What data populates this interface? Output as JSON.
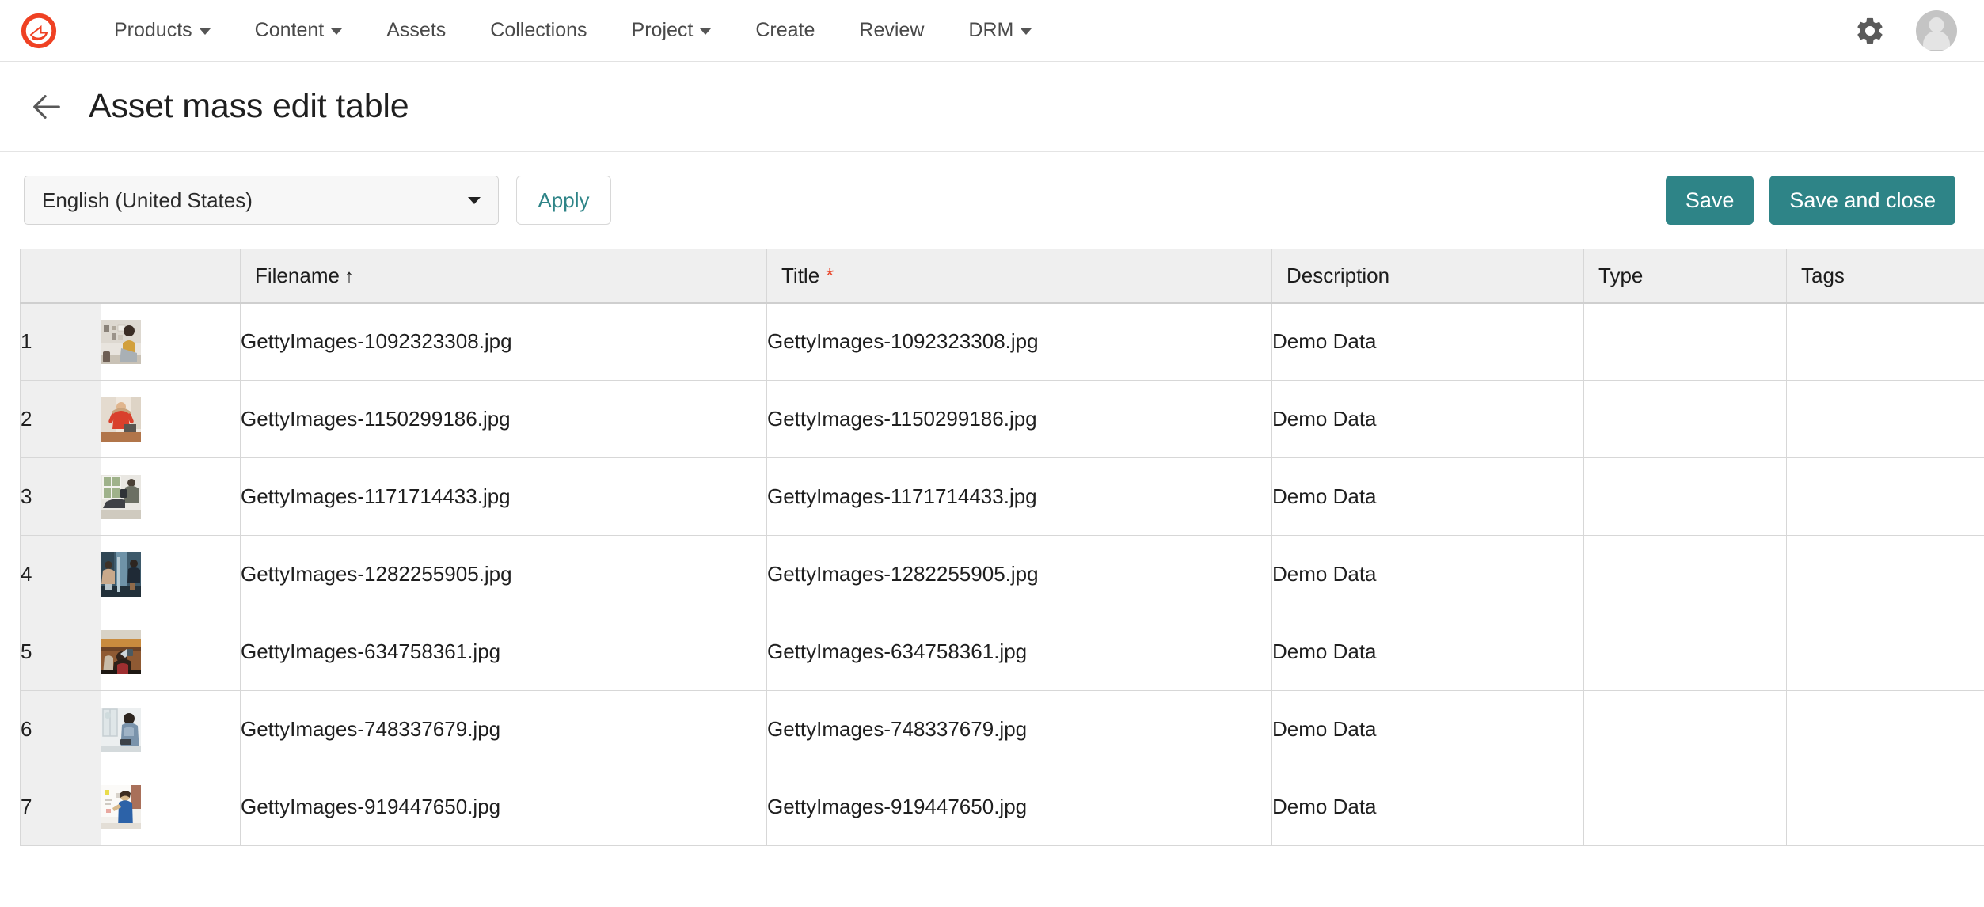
{
  "nav": {
    "logo_icon": "brand-ring-logo",
    "items": [
      {
        "label": "Products",
        "has_caret": true
      },
      {
        "label": "Content",
        "has_caret": true
      },
      {
        "label": "Assets",
        "has_caret": false
      },
      {
        "label": "Collections",
        "has_caret": false
      },
      {
        "label": "Project",
        "has_caret": true
      },
      {
        "label": "Create",
        "has_caret": false
      },
      {
        "label": "Review",
        "has_caret": false
      },
      {
        "label": "DRM",
        "has_caret": true
      }
    ],
    "settings_icon": "gear-icon",
    "avatar_icon": "user-avatar-icon"
  },
  "titlebar": {
    "back_icon": "back-arrow-icon",
    "title": "Asset mass edit table"
  },
  "toolbar": {
    "language_selected": "English (United States)",
    "apply_label": "Apply",
    "save_label": "Save",
    "save_and_close_label": "Save and close",
    "accent_color": "#2e8487",
    "apply_text_color": "#2e8487"
  },
  "table": {
    "columns": [
      {
        "key": "number",
        "label": ""
      },
      {
        "key": "thumbnail",
        "label": ""
      },
      {
        "key": "filename",
        "label": "Filename",
        "sort": "↑"
      },
      {
        "key": "title",
        "label": "Title",
        "required": "*"
      },
      {
        "key": "description",
        "label": "Description"
      },
      {
        "key": "type",
        "label": "Type"
      },
      {
        "key": "tags",
        "label": "Tags"
      }
    ],
    "required_marker_color": "#e8492e",
    "rows": [
      {
        "number": "1",
        "filename": "GettyImages-1092323308.jpg",
        "title": "GettyImages-1092323308.jpg",
        "description": "Demo Data",
        "type": "",
        "tags": "",
        "thumbnail_alt": "woman-at-desk-thumbnail"
      },
      {
        "number": "2",
        "filename": "GettyImages-1150299186.jpg",
        "title": "GettyImages-1150299186.jpg",
        "description": "Demo Data",
        "type": "",
        "tags": "",
        "thumbnail_alt": "woman-in-red-stretching-thumbnail"
      },
      {
        "number": "3",
        "filename": "GettyImages-1171714433.jpg",
        "title": "GettyImages-1171714433.jpg",
        "description": "Demo Data",
        "type": "",
        "tags": "",
        "thumbnail_alt": "person-reading-by-window-thumbnail"
      },
      {
        "number": "4",
        "filename": "GettyImages-1282255905.jpg",
        "title": "GettyImages-1282255905.jpg",
        "description": "Demo Data",
        "type": "",
        "tags": "",
        "thumbnail_alt": "people-at-counter-thumbnail"
      },
      {
        "number": "5",
        "filename": "GettyImages-634758361.jpg",
        "title": "GettyImages-634758361.jpg",
        "description": "Demo Data",
        "type": "",
        "tags": "",
        "thumbnail_alt": "person-at-wooden-table-thumbnail"
      },
      {
        "number": "6",
        "filename": "GettyImages-748337679.jpg",
        "title": "GettyImages-748337679.jpg",
        "description": "Demo Data",
        "type": "",
        "tags": "",
        "thumbnail_alt": "woman-thinking-by-window-thumbnail"
      },
      {
        "number": "7",
        "filename": "GettyImages-919447650.jpg",
        "title": "GettyImages-919447650.jpg",
        "description": "Demo Data",
        "type": "",
        "tags": "",
        "thumbnail_alt": "woman-at-whiteboard-thumbnail"
      }
    ]
  }
}
